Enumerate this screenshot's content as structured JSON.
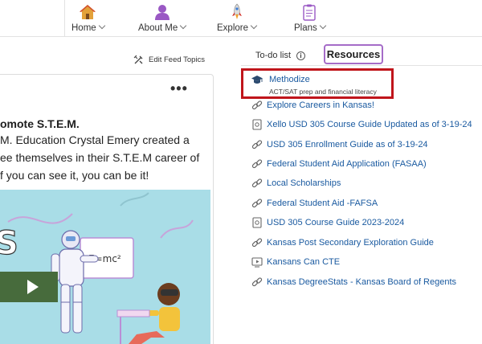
{
  "nav": {
    "items": [
      {
        "label": "Home",
        "icon": "home-icon"
      },
      {
        "label": "About Me",
        "icon": "person-icon"
      },
      {
        "label": "Explore",
        "icon": "rocket-icon"
      },
      {
        "label": "Plans",
        "icon": "clipboard-icon"
      }
    ]
  },
  "feed": {
    "edit_topics_label": "Edit Feed Topics",
    "more_label": "•••",
    "post": {
      "title": "omote S.T.E.M.",
      "lines": [
        "M. Education Crystal Emery created a",
        "ee themselves in their S.T.E.M career of",
        "f you can see it, you can be it!"
      ],
      "image_whiteboard_text": "E=mc²"
    }
  },
  "panel": {
    "tab_todo": "To-do list",
    "info_glyph": "i",
    "tab_resources": "Resources",
    "resources": [
      {
        "label": "Methodize",
        "subtitle": "ACT/SAT prep and financial literacy",
        "icon": "graduation-cap-icon"
      },
      {
        "label": "Explore Careers in Kansas!",
        "icon": "link-icon"
      },
      {
        "label": "Xello USD 305 Course Guide Updated as of 3-19-24",
        "icon": "document-icon"
      },
      {
        "label": "USD 305 Enrollment Guide as of 3-19-24",
        "icon": "link-icon"
      },
      {
        "label": "Federal Student Aid Application (FASAA)",
        "icon": "link-icon"
      },
      {
        "label": "Local Scholarships",
        "icon": "link-icon"
      },
      {
        "label": "Federal Student Aid -FAFSA",
        "icon": "link-icon"
      },
      {
        "label": "USD 305 Course Guide 2023-2024",
        "icon": "document-icon"
      },
      {
        "label": "Kansas Post Secondary Exploration Guide",
        "icon": "link-icon"
      },
      {
        "label": "Kansans Can CTE",
        "icon": "video-icon"
      },
      {
        "label": "Kansas DegreeStats - Kansas Board of Regents",
        "icon": "link-icon"
      }
    ]
  },
  "colors": {
    "link": "#1a5aa0",
    "highlight": "#c0151b",
    "tab_border": "#a56cc8"
  }
}
